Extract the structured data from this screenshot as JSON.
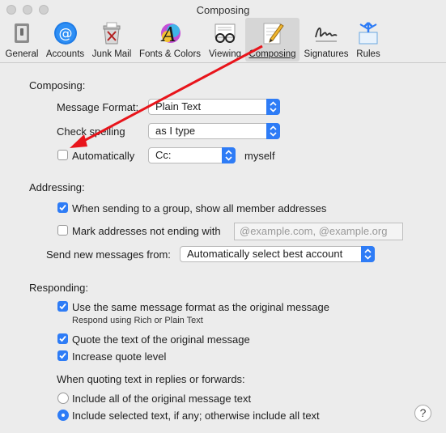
{
  "window": {
    "title": "Composing"
  },
  "toolbar": {
    "items": [
      {
        "label": "General",
        "icon": "general-icon"
      },
      {
        "label": "Accounts",
        "icon": "at-icon"
      },
      {
        "label": "Junk Mail",
        "icon": "junk-mail-icon"
      },
      {
        "label": "Fonts & Colors",
        "icon": "fonts-colors-icon"
      },
      {
        "label": "Viewing",
        "icon": "glasses-icon"
      },
      {
        "label": "Composing",
        "icon": "pencil-icon"
      },
      {
        "label": "Signatures",
        "icon": "signature-icon"
      },
      {
        "label": "Rules",
        "icon": "rules-icon"
      }
    ],
    "selected": "Composing"
  },
  "composing": {
    "header": "Composing:",
    "message_format_label": "Message Format:",
    "message_format_value": "Plain Text",
    "check_spelling_label": "Check spelling",
    "check_spelling_value": "as I type",
    "auto_label": "Automatically",
    "auto_checked": false,
    "auto_cc_value": "Cc:",
    "auto_suffix": "myself"
  },
  "addressing": {
    "header": "Addressing:",
    "group_label": "When sending to a group, show all member addresses",
    "group_checked": true,
    "mark_label": "Mark addresses not ending with",
    "mark_checked": false,
    "mark_placeholder": "@example.com, @example.org",
    "send_from_label": "Send new messages from:",
    "send_from_value": "Automatically select best account"
  },
  "responding": {
    "header": "Responding:",
    "same_format_label": "Use the same message format as the original message",
    "same_format_checked": true,
    "same_format_sub": "Respond using Rich or Plain Text",
    "quote_label": "Quote the text of the original message",
    "quote_checked": true,
    "increase_label": "Increase quote level",
    "increase_checked": true,
    "when_quoting_label": "When quoting text in replies or forwards:",
    "include_all_label": "Include all of the original message text",
    "include_selected_label": "Include selected text, if any; otherwise include all text",
    "selected_option": "include_selected"
  },
  "help": {
    "label": "?"
  },
  "annotation": {
    "arrow_color": "#e8141b"
  }
}
